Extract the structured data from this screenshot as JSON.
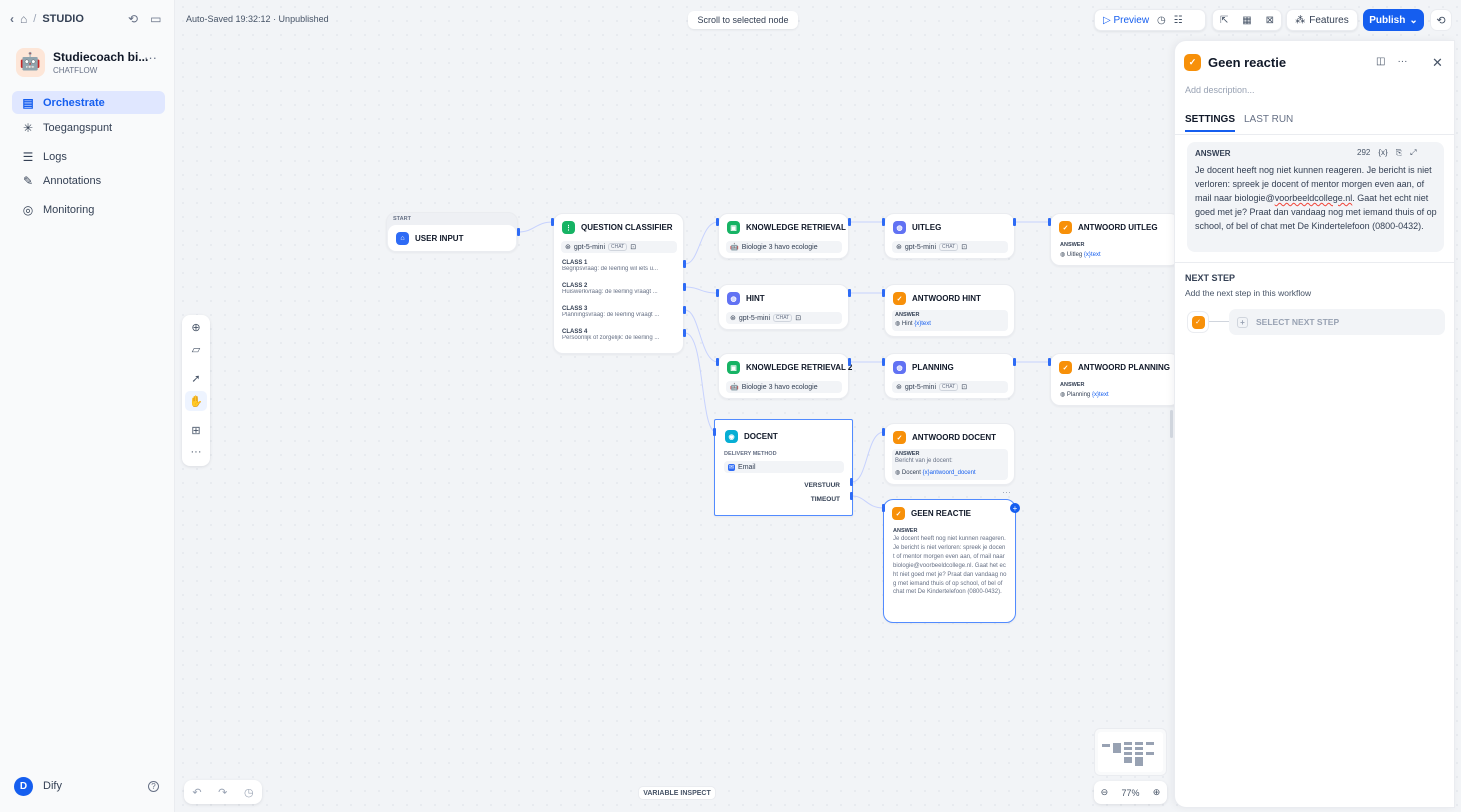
{
  "sidebar": {
    "breadcrumb": "STUDIO",
    "app_name": "Studiecoach bi...",
    "app_type": "CHATFLOW",
    "app_emoji": "🤖",
    "nav": [
      {
        "label": "Orchestrate",
        "icon": "workflow-icon"
      },
      {
        "label": "Toegangspunt",
        "icon": "access-point-icon"
      },
      {
        "label": "Logs",
        "icon": "logs-icon"
      },
      {
        "label": "Annotations",
        "icon": "annotations-icon"
      },
      {
        "label": "Monitoring",
        "icon": "monitoring-icon"
      }
    ],
    "user_initial": "D",
    "user_name": "Dify"
  },
  "header": {
    "autosave": "Auto-Saved 19:32:12 · Unpublished",
    "scroll_btn": "Scroll to selected node",
    "preview": "Preview",
    "features": "Features",
    "publish": "Publish"
  },
  "nodes": {
    "start": {
      "label": "START",
      "title": "USER INPUT"
    },
    "classifier": {
      "title": "QUESTION CLASSIFIER",
      "model": "gpt-5-mini",
      "model_tag": "CHAT",
      "classes": [
        {
          "title": "CLASS 1",
          "desc": "Begripsvraag: de leerling wil iets u..."
        },
        {
          "title": "CLASS 2",
          "desc": "Huiswerkvraag: de leerling vraagt ..."
        },
        {
          "title": "CLASS 3",
          "desc": "Planningsvraag: de leerling vraagt ..."
        },
        {
          "title": "CLASS 4",
          "desc": "Persoonlijk of zorgelijk: de leerling ..."
        }
      ]
    },
    "kr1": {
      "title": "KNOWLEDGE RETRIEVAL",
      "kb": "Biologie 3 havo ecologie"
    },
    "hint": {
      "title": "HINT",
      "model": "gpt-5-mini",
      "model_tag": "CHAT"
    },
    "kr2": {
      "title": "KNOWLEDGE RETRIEVAL 2",
      "kb": "Biologie 3 havo ecologie"
    },
    "docent": {
      "title": "DOCENT",
      "method_label": "DELIVERY METHOD",
      "method": "Email",
      "branch1": "VERSTUUR",
      "branch2": "TIMEOUT"
    },
    "uitleg": {
      "title": "UITLEG",
      "model": "gpt-5-mini",
      "model_tag": "CHAT"
    },
    "antwoord_hint": {
      "title": "ANTWOORD HINT",
      "answer_label": "ANSWER",
      "var_node": "Hint",
      "var_name": "text"
    },
    "planning": {
      "title": "PLANNING",
      "model": "gpt-5-mini",
      "model_tag": "CHAT"
    },
    "antwoord_docent": {
      "title": "ANTWOORD DOCENT",
      "answer_label": "ANSWER",
      "text": "Bericht van je docent:",
      "var_node": "Docent",
      "var_name": "antwoord_docent"
    },
    "geen_reactie": {
      "title": "GEEN REACTIE",
      "answer_label": "ANSWER",
      "text": "Je docent heeft nog niet kunnen reageren. Je bericht is niet verloren: spreek je docent of mentor morgen even aan, of mail naar biologie@voorbeeldcollege.nl. Gaat het echt niet goed met je? Praat dan vandaag nog met iemand thuis of op school, of bel of chat met De Kindertelefoon (0800-0432)."
    },
    "antwoord_uitleg": {
      "title": "ANTWOORD UITLEG",
      "answer_label": "ANSWER",
      "var_node": "Uitleg",
      "var_name": "text"
    },
    "antwoord_planning": {
      "title": "ANTWOORD PLANNING",
      "answer_label": "ANSWER",
      "var_node": "Planning",
      "var_name": "text"
    }
  },
  "panel": {
    "title": "Geen reactie",
    "desc_placeholder": "Add description...",
    "tabs": [
      "SETTINGS",
      "LAST RUN"
    ],
    "answer_label": "ANSWER",
    "char_count": "292",
    "var_btn": "{x}",
    "answer_text_before": "Je docent heeft nog niet kunnen reageren. Je bericht is niet verloren: spreek je docent of mentor morgen even aan, of mail naar biologie@",
    "answer_text_err": "voorbeeldcollege.nl",
    "answer_text_after": ". Gaat het echt niet goed met je? Praat dan vandaag nog met iemand thuis of op school, of bel of chat met De Kindertelefoon (0800-0432).",
    "next_step_title": "NEXT STEP",
    "next_step_desc": "Add the next step in this workflow",
    "select_next": "SELECT NEXT STEP"
  },
  "bottom": {
    "variable_inspect": "VARIABLE INSPECT",
    "zoom": "77%"
  }
}
